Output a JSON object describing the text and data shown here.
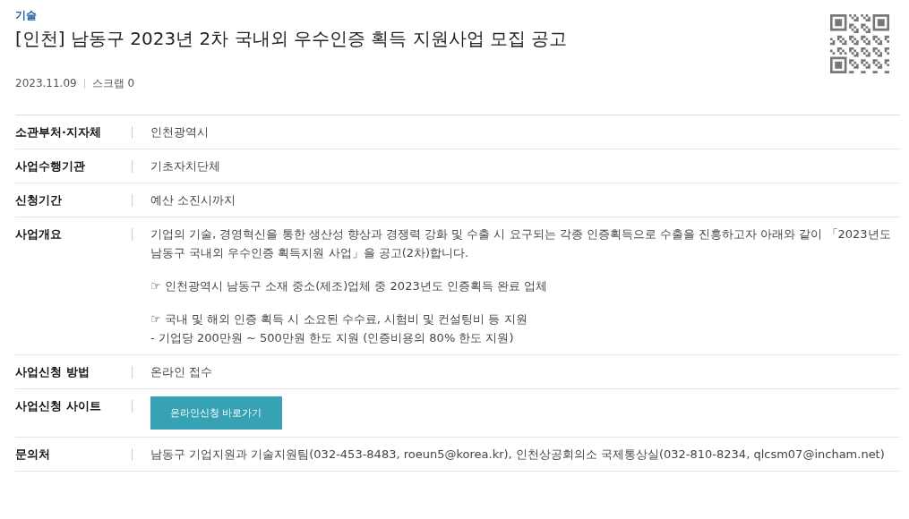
{
  "category": "기술",
  "title": "[인천] 남동구 2023년 2차 국내외 우수인증 획득 지원사업 모집 공고",
  "meta": {
    "date": "2023.11.09",
    "scrap": "스크랩 0"
  },
  "rows": [
    {
      "kind": "text",
      "label": "소관부처·지자체",
      "value": "인천광역시"
    },
    {
      "kind": "text",
      "label": "사업수행기관",
      "value": "기초자치단체"
    },
    {
      "kind": "text",
      "label": "신청기간",
      "value": "예산 소진시까지"
    },
    {
      "kind": "paragraphs",
      "label": "사업개요",
      "paragraphs": [
        [
          "기업의 기술, 경영혁신을 통한 생산성 향상과 경쟁력 강화 및 수출 시 요구되는 각종 인증획득으로 수출을 진흥하고자 아래와 같이 「2023년도 남동구 국내외 우수인증 획득지원 사업」을 공고(2차)합니다."
        ],
        [
          "☞ 인천광역시 남동구 소재 중소(제조)업체 중 2023년도 인증획득 완료 업체"
        ],
        [
          "☞ 국내 및 해외 인증 획득 시 소요된 수수료, 시험비 및 컨설팅비 등 지원",
          "- 기업당 200만원 ~ 500만원 한도 지원 (인증비용의 80% 한도 지원)"
        ]
      ]
    },
    {
      "kind": "text",
      "label": "사업신청 방법",
      "value": "온라인 접수"
    },
    {
      "kind": "button",
      "label": "사업신청 사이트",
      "button": "온라인신청 바로가기"
    },
    {
      "kind": "text",
      "label": "문의처",
      "value": "남동구 기업지원과 기술지원팀(032-453-8483, roeun5@korea.kr), 인천상공회의소 국제통상실(032-810-8234, qlcsm07@incham.net)"
    }
  ]
}
